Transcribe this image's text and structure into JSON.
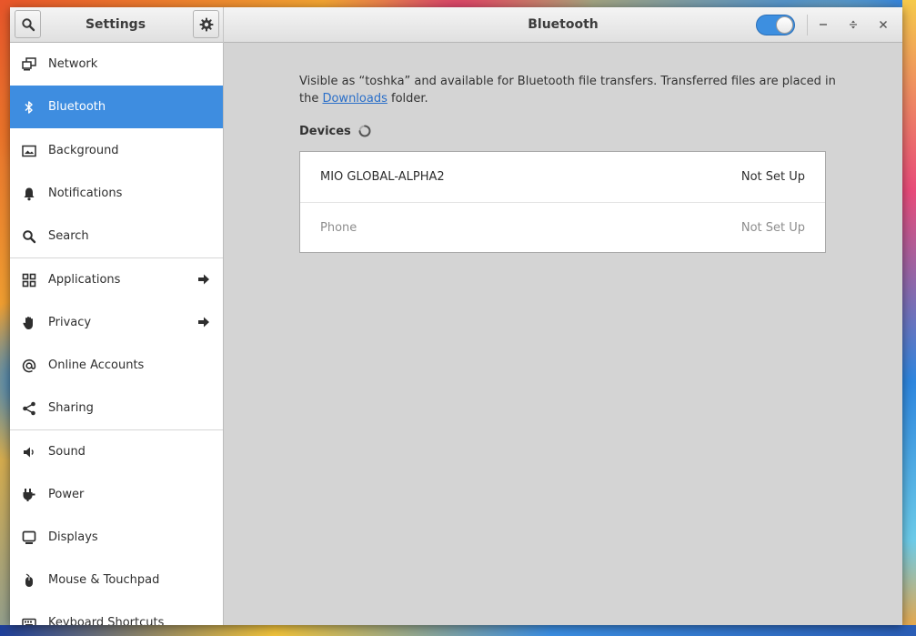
{
  "window": {
    "sidebar_title": "Settings",
    "main_title": "Bluetooth",
    "bluetooth_enabled": true
  },
  "sidebar": {
    "items": [
      {
        "label": "Network",
        "icon": "network-icon"
      },
      {
        "label": "Bluetooth",
        "icon": "bluetooth-icon",
        "active": true
      },
      {
        "label": "Background",
        "icon": "background-icon"
      },
      {
        "label": "Notifications",
        "icon": "bell-icon"
      },
      {
        "label": "Search",
        "icon": "search-icon"
      },
      {
        "label": "Applications",
        "icon": "grid-icon",
        "has_submenu": true
      },
      {
        "label": "Privacy",
        "icon": "hand-icon",
        "has_submenu": true
      },
      {
        "label": "Online Accounts",
        "icon": "at-icon"
      },
      {
        "label": "Sharing",
        "icon": "share-icon"
      },
      {
        "label": "Sound",
        "icon": "speaker-icon"
      },
      {
        "label": "Power",
        "icon": "power-icon"
      },
      {
        "label": "Displays",
        "icon": "display-icon"
      },
      {
        "label": "Mouse & Touchpad",
        "icon": "mouse-icon"
      },
      {
        "label": "Keyboard Shortcuts",
        "icon": "keyboard-icon"
      }
    ]
  },
  "main": {
    "desc_before": "Visible as “toshka” and available for Bluetooth file transfers. Transferred files are placed in the ",
    "desc_link": "Downloads",
    "desc_after": " folder.",
    "devices_label": "Devices",
    "devices": [
      {
        "name": "MIO GLOBAL-ALPHA2",
        "status": "Not Set Up",
        "dimmed": false
      },
      {
        "name": "Phone",
        "status": "Not Set Up",
        "dimmed": true
      }
    ]
  },
  "colors": {
    "accent": "#3e8de0",
    "sidebar_bg": "#ffffff",
    "content_bg": "#d4d4d4"
  }
}
